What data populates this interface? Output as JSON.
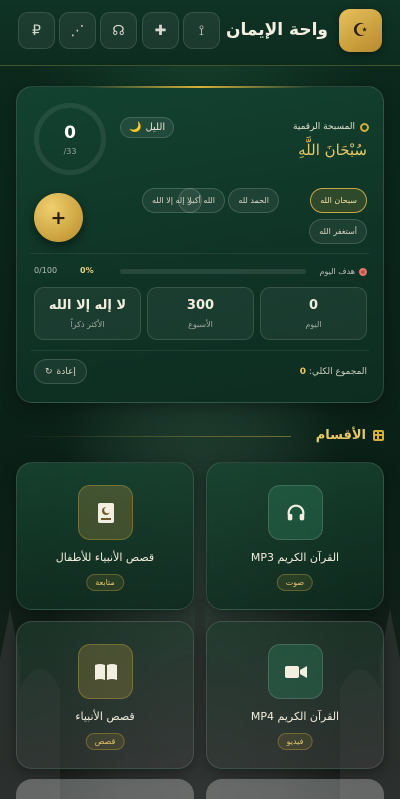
{
  "header": {
    "title": "واحة الإيمان",
    "logo_icon": "crescent-star-icon",
    "buttons": [
      {
        "icon": "paypal-icon",
        "glyph": "₽"
      },
      {
        "icon": "share-icon",
        "glyph": "⋰"
      },
      {
        "icon": "headset-icon",
        "glyph": "☊"
      },
      {
        "icon": "puzzle-icon",
        "glyph": "✚"
      },
      {
        "icon": "broadcast-icon",
        "glyph": "⟟"
      }
    ]
  },
  "counter": {
    "label": "المسبحة الرقمية",
    "current_dhikr": "سُبْحَانَ اللَّهِ",
    "count": "0",
    "target": "/33",
    "period": "الليل",
    "period_icon": "🌙",
    "add_label": "+",
    "chips": [
      {
        "label": "سبحان الله",
        "active": true
      },
      {
        "label": "الحمد لله",
        "active": false
      },
      {
        "label": "الله أكبر",
        "active": false
      },
      {
        "label": "لا إله إلا الله",
        "active": false
      },
      {
        "label": "أستغفر الله",
        "active": false
      }
    ],
    "goal": {
      "label": "هدف اليوم",
      "percent_text": "0%",
      "progress": 0,
      "count": "0/100"
    },
    "stats": [
      {
        "value": "0",
        "label": "اليوم"
      },
      {
        "value": "300",
        "label": "الأسبوع"
      },
      {
        "value": "لا إله إلا الله",
        "label": "الأكثر ذكراً"
      }
    ],
    "total_label": "المجموع الكلي:",
    "total_value": "0",
    "reset_label": "إعادة"
  },
  "sections": {
    "title": "الأقسام",
    "tiles": [
      {
        "title": "القرآن الكريم MP3",
        "badge": "صوت",
        "icon": "headphones-icon",
        "glyph": "🎧"
      },
      {
        "title": "قصص الأنبياء للأطفال",
        "badge": "متابعة",
        "icon": "book-crescent-icon",
        "glyph": "☪"
      },
      {
        "title": "القرآن الكريم MP4",
        "badge": "فيديو",
        "icon": "video-camera-icon",
        "glyph": "■"
      },
      {
        "title": "قصص الأنبياء",
        "badge": "قصص",
        "icon": "open-book-icon",
        "glyph": "📖"
      }
    ]
  },
  "colors": {
    "accent": "#d4af37",
    "background": "#0b2218"
  }
}
